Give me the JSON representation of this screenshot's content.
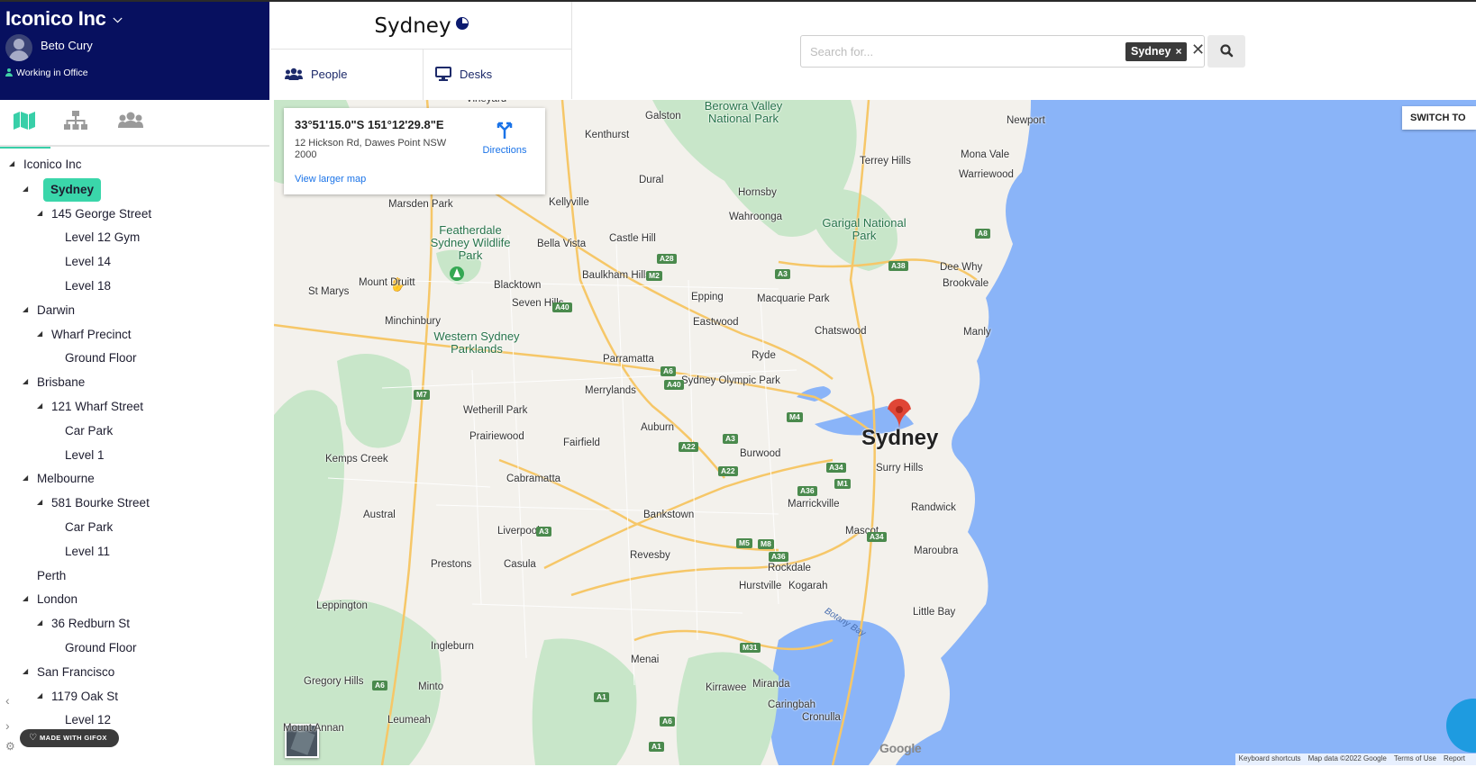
{
  "org": {
    "name": "Iconico Inc",
    "user": "Beto Cury",
    "status": "Working in Office"
  },
  "view_tabs": [
    "map-icon",
    "org-chart-icon",
    "people-group-icon"
  ],
  "location_title": "Sydney",
  "tabs": {
    "people": "People",
    "desks": "Desks"
  },
  "search": {
    "placeholder": "Search for...",
    "chip": "Sydney",
    "chip_remove": "×",
    "clear": "✕"
  },
  "tree": [
    {
      "label": "Iconico Inc",
      "depth": 0,
      "expanded": true
    },
    {
      "label": "Sydney",
      "depth": 1,
      "expanded": true,
      "selected": true
    },
    {
      "label": "145 George Street",
      "depth": 2,
      "expanded": true
    },
    {
      "label": "Level 12 Gym",
      "depth": 3
    },
    {
      "label": "Level 14",
      "depth": 3
    },
    {
      "label": "Level 18",
      "depth": 3
    },
    {
      "label": "Darwin",
      "depth": 1,
      "expanded": true
    },
    {
      "label": "Wharf Precinct",
      "depth": 2,
      "expanded": true
    },
    {
      "label": "Ground Floor",
      "depth": 3
    },
    {
      "label": "Brisbane",
      "depth": 1,
      "expanded": true
    },
    {
      "label": "121 Wharf Street",
      "depth": 2,
      "expanded": true
    },
    {
      "label": "Car Park",
      "depth": 3
    },
    {
      "label": "Level 1",
      "depth": 3
    },
    {
      "label": "Melbourne",
      "depth": 1,
      "expanded": true
    },
    {
      "label": "581 Bourke Street",
      "depth": 2,
      "expanded": true
    },
    {
      "label": "Car Park",
      "depth": 3
    },
    {
      "label": "Level 11",
      "depth": 3
    },
    {
      "label": "Perth",
      "depth": 1
    },
    {
      "label": "London",
      "depth": 1,
      "expanded": true
    },
    {
      "label": "36 Redburn St",
      "depth": 2,
      "expanded": true
    },
    {
      "label": "Ground Floor",
      "depth": 3
    },
    {
      "label": "San Francisco",
      "depth": 1,
      "expanded": true
    },
    {
      "label": "1179 Oak St",
      "depth": 2,
      "expanded": true
    },
    {
      "label": "Level 12",
      "depth": 3
    }
  ],
  "gifox_badge": "MADE WITH GIFOX",
  "map": {
    "coords": "33°51'15.0\"S 151°12'29.8\"E",
    "address": "12 Hickson Rd, Dawes Point NSW 2000",
    "view_larger": "View larger map",
    "directions": "Directions",
    "switch_button": "SWITCH TO",
    "google": "Google",
    "attribution": [
      "Keyboard shortcuts",
      "Map data ©2022 Google",
      "Terms of Use",
      "Report"
    ],
    "places": [
      "Vineyard",
      "Galston",
      "Berowra Valley National Park",
      "Kenthurst",
      "Newport",
      "Dural",
      "Terrey Hills",
      "Mona Vale",
      "Warriewood",
      "Marsden Park",
      "Kellyville",
      "Hornsby",
      "Wahroonga",
      "Featherdale Sydney Wildlife Park",
      "Bella Vista",
      "Castle Hill",
      "Garigal National Park",
      "Dee Why",
      "Brookvale",
      "Mount Druitt",
      "St Marys",
      "Blacktown",
      "Baulkham Hills",
      "Seven Hills",
      "Epping",
      "Macquarie Park",
      "Minchinbury",
      "Eastwood",
      "Chatswood",
      "Manly",
      "Western Sydney Parklands",
      "Parramatta",
      "Ryde",
      "Merrylands",
      "Sydney Olympic Park",
      "Wetherill Park",
      "Auburn",
      "Prairiewood",
      "Fairfield",
      "Burwood",
      "Sydney",
      "Kemps Creek",
      "Cabramatta",
      "Surry Hills",
      "Marrickville",
      "Randwick",
      "Austral",
      "Liverpool",
      "Bankstown",
      "Mascot",
      "Maroubra",
      "Prestons",
      "Casula",
      "Revesby",
      "Rockdale",
      "Hurstville",
      "Kogarah",
      "Leppington",
      "Botany Bay",
      "Little Bay",
      "Ingleburn",
      "Menai",
      "Gregory Hills",
      "Minto",
      "Kirrawee",
      "Miranda",
      "Caringbah",
      "Leumeah",
      "Cronulla",
      "Mount Annan"
    ],
    "road_shields": [
      "M7",
      "A28",
      "M2",
      "A3",
      "A38",
      "A8",
      "A40",
      "A6",
      "A40",
      "M4",
      "A3",
      "A22",
      "A22",
      "A34",
      "A36",
      "M1",
      "A34",
      "A3",
      "M5",
      "M8",
      "A36",
      "A6",
      "M31",
      "A1",
      "A6",
      "A1"
    ]
  }
}
